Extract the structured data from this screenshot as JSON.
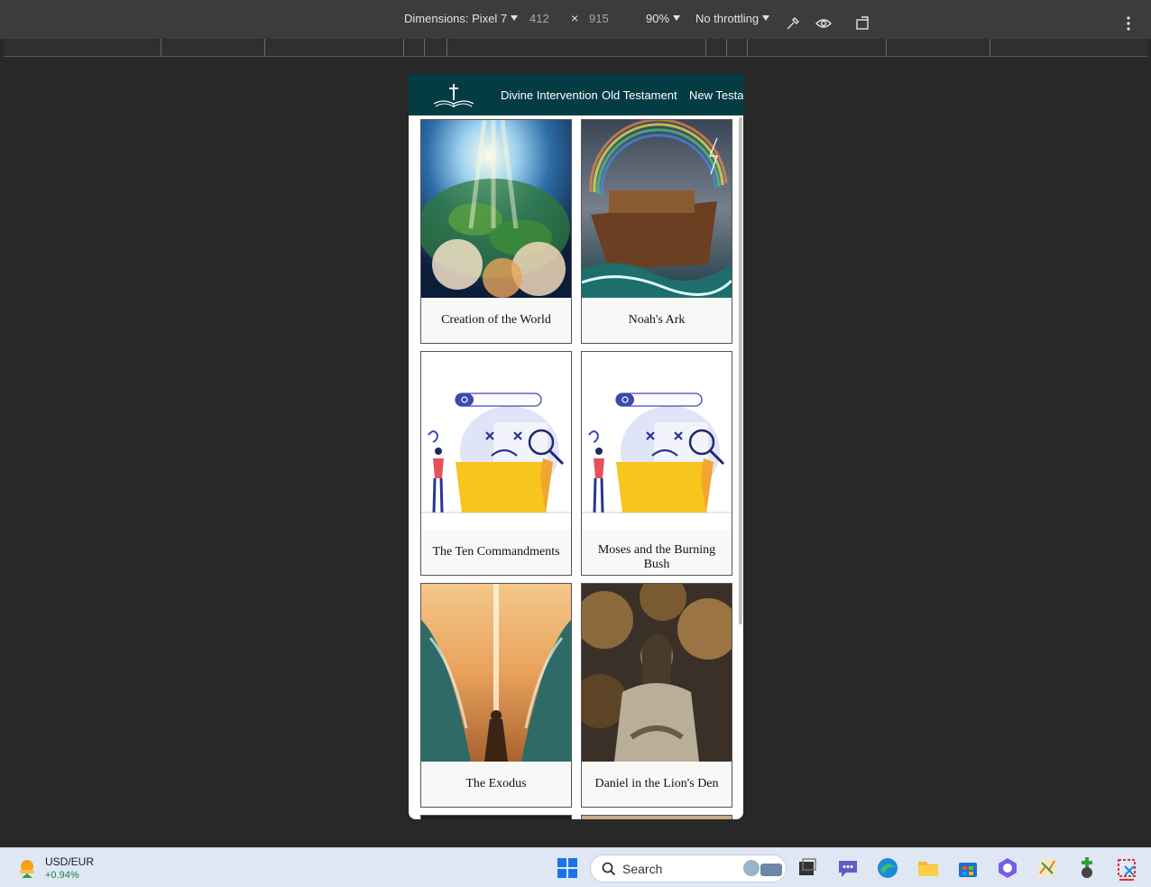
{
  "devtools": {
    "dimensions_label": "Dimensions: Pixel 7",
    "width": "412",
    "times": "×",
    "height": "915",
    "zoom": "90%",
    "throttling": "No throttling",
    "icons": [
      "eyedropper-icon",
      "eye-icon",
      "rotate-icon",
      "more-vert-icon"
    ]
  },
  "site": {
    "nav_bg": "#033d43",
    "logo_icon": "open-bible-cross-icon",
    "nav_links": [
      "Divine Intervention",
      "Old Testament",
      "New Testament"
    ]
  },
  "cards": [
    {
      "title": "Creation of the World"
    },
    {
      "title": "Noah's Ark"
    },
    {
      "title": "The Ten Commandments"
    },
    {
      "title": "Moses and the Burning Bush"
    },
    {
      "title": "The Exodus"
    },
    {
      "title": "Daniel in the Lion's Den"
    }
  ],
  "taskbar": {
    "widget_title": "USD/EUR",
    "widget_change": "+0.94%",
    "widget_change_color": "#1a7f37",
    "search_label": "Search",
    "apps": [
      "windows-start-icon",
      "file-explorer-icon",
      "teams-chat-icon",
      "edge-icon",
      "folder-icon",
      "store-icon",
      "copilot-icon",
      "snip-icon",
      "game-icon",
      "snipping-tool-icon"
    ]
  }
}
